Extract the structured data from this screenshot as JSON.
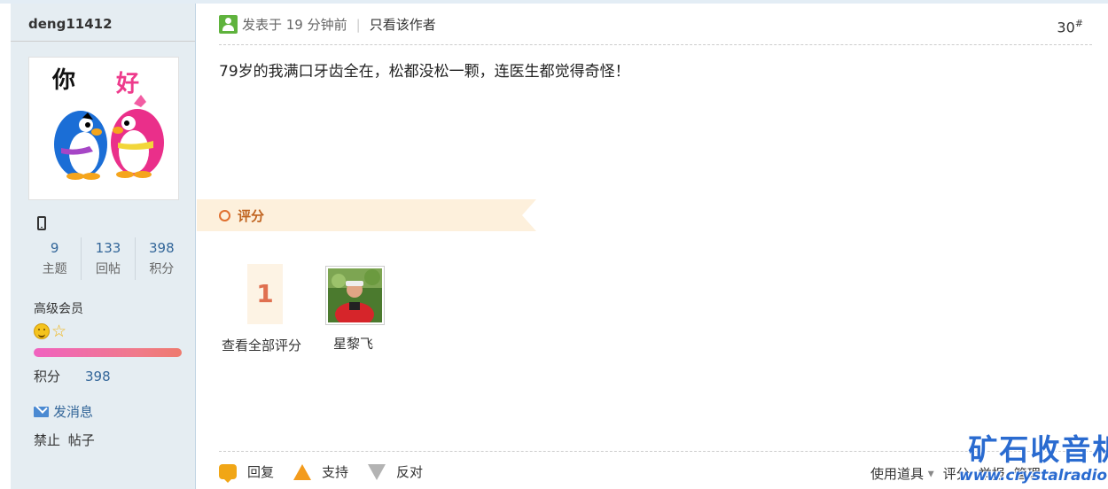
{
  "sidebar": {
    "username": "deng11412",
    "stats": [
      {
        "value": "9",
        "label": "主题"
      },
      {
        "value": "133",
        "label": "回帖"
      },
      {
        "value": "398",
        "label": "积分"
      }
    ],
    "level": "高级会员",
    "points_label": "积分",
    "points_value": "398",
    "send_message": "发消息",
    "ban_label": "禁止 帖子",
    "avatar_text": [
      "你",
      "好"
    ]
  },
  "post": {
    "posted_time": "发表于 19 分钟前",
    "only_author": "只看该作者",
    "floor_number": "30",
    "floor_suffix": "#",
    "content": "79岁的我满口牙齿全在，松都没松一颗，连医生都觉得奇怪！"
  },
  "rating": {
    "section_label": "评分",
    "score": "1",
    "view_all": "查看全部评分",
    "rater_name": "星黎飞"
  },
  "actions": {
    "reply": "回复",
    "support": "支持",
    "oppose": "反对",
    "use_tools": "使用道具",
    "rate": "评分",
    "report": "举报",
    "manage": "管理"
  },
  "watermark": {
    "title": "矿石收音机",
    "url": "www.crystalradio.cn"
  },
  "colors": {
    "sidebar_bg": "#e5edf2",
    "link_blue": "#336699",
    "rating_banner": "#fdf0dc",
    "accent_orange": "#e07050"
  }
}
